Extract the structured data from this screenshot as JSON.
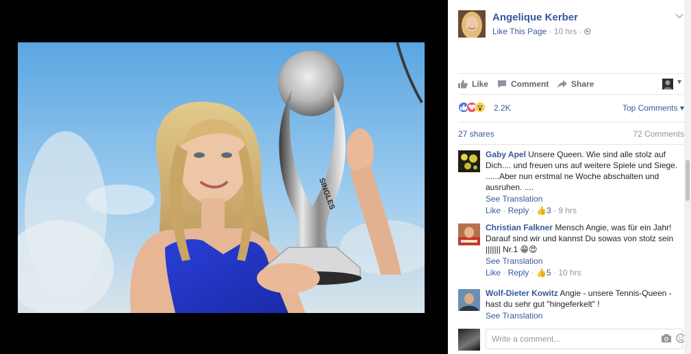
{
  "post": {
    "page_name": "Angelique Kerber",
    "like_page": "Like This Page",
    "separator": "·",
    "time": "10 hrs",
    "separator2": "·"
  },
  "photo": {
    "trophy_text": "SINGLES"
  },
  "actions": {
    "like": "Like",
    "comment": "Comment",
    "share": "Share"
  },
  "reactions": {
    "count": "2.2K",
    "top_comments": "Top Comments ▾"
  },
  "counts": {
    "shares": "27 shares",
    "comments": "72 Comments"
  },
  "comments": [
    {
      "author": "Gaby Apel",
      "text": "Unsere Queen. Wie sind alle stolz auf Dich.... und freuen uns auf weitere Spiele und Siege. ......Aber nun erstmal ne Woche abschalten und ausruhen. ....",
      "translation": "See Translation",
      "like": "Like",
      "reply": "Reply",
      "likes": "3",
      "time": "9 hrs"
    },
    {
      "author": "Christian Falkner",
      "text": "Mensch Angie, was für ein Jahr! Darauf sind wir und kannst Du sowas von stolz sein ||||||| Nr.1 😁😍",
      "translation": "See Translation",
      "like": "Like",
      "reply": "Reply",
      "likes": "5",
      "time": "10 hrs"
    },
    {
      "author": "Wolf-Dieter Kowitz",
      "text": "Angie - unsere Tennis-Queen - hast du sehr gut \"hingeferkelt\" !",
      "translation": "See Translation"
    }
  ],
  "write_comment": {
    "placeholder": "Write a comment..."
  },
  "colors": {
    "link": "#365899",
    "meta": "#90949c",
    "like_reaction": "#4b7bde",
    "love_reaction": "#f25268",
    "wow_reaction": "#f7cf48"
  }
}
